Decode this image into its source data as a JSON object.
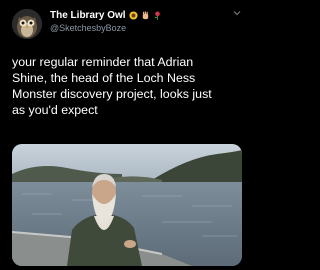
{
  "tweet": {
    "display_name": "The Library Owl",
    "handle": "@SketchesbyBoze",
    "badge_icons": [
      "sunflower-emoji-icon",
      "hand-emoji-icon",
      "rose-emoji-icon"
    ],
    "text_lines": [
      "your regular reminder that Adrian",
      "Shine, the head of the Loch Ness",
      "Monster discovery project, looks just",
      "as you'd expect"
    ],
    "media": {
      "icon": "photo-man-on-boat-lake-icon"
    }
  },
  "colors": {
    "background": "#000000",
    "text": "#ffffff",
    "secondary": "#8b98a5"
  }
}
